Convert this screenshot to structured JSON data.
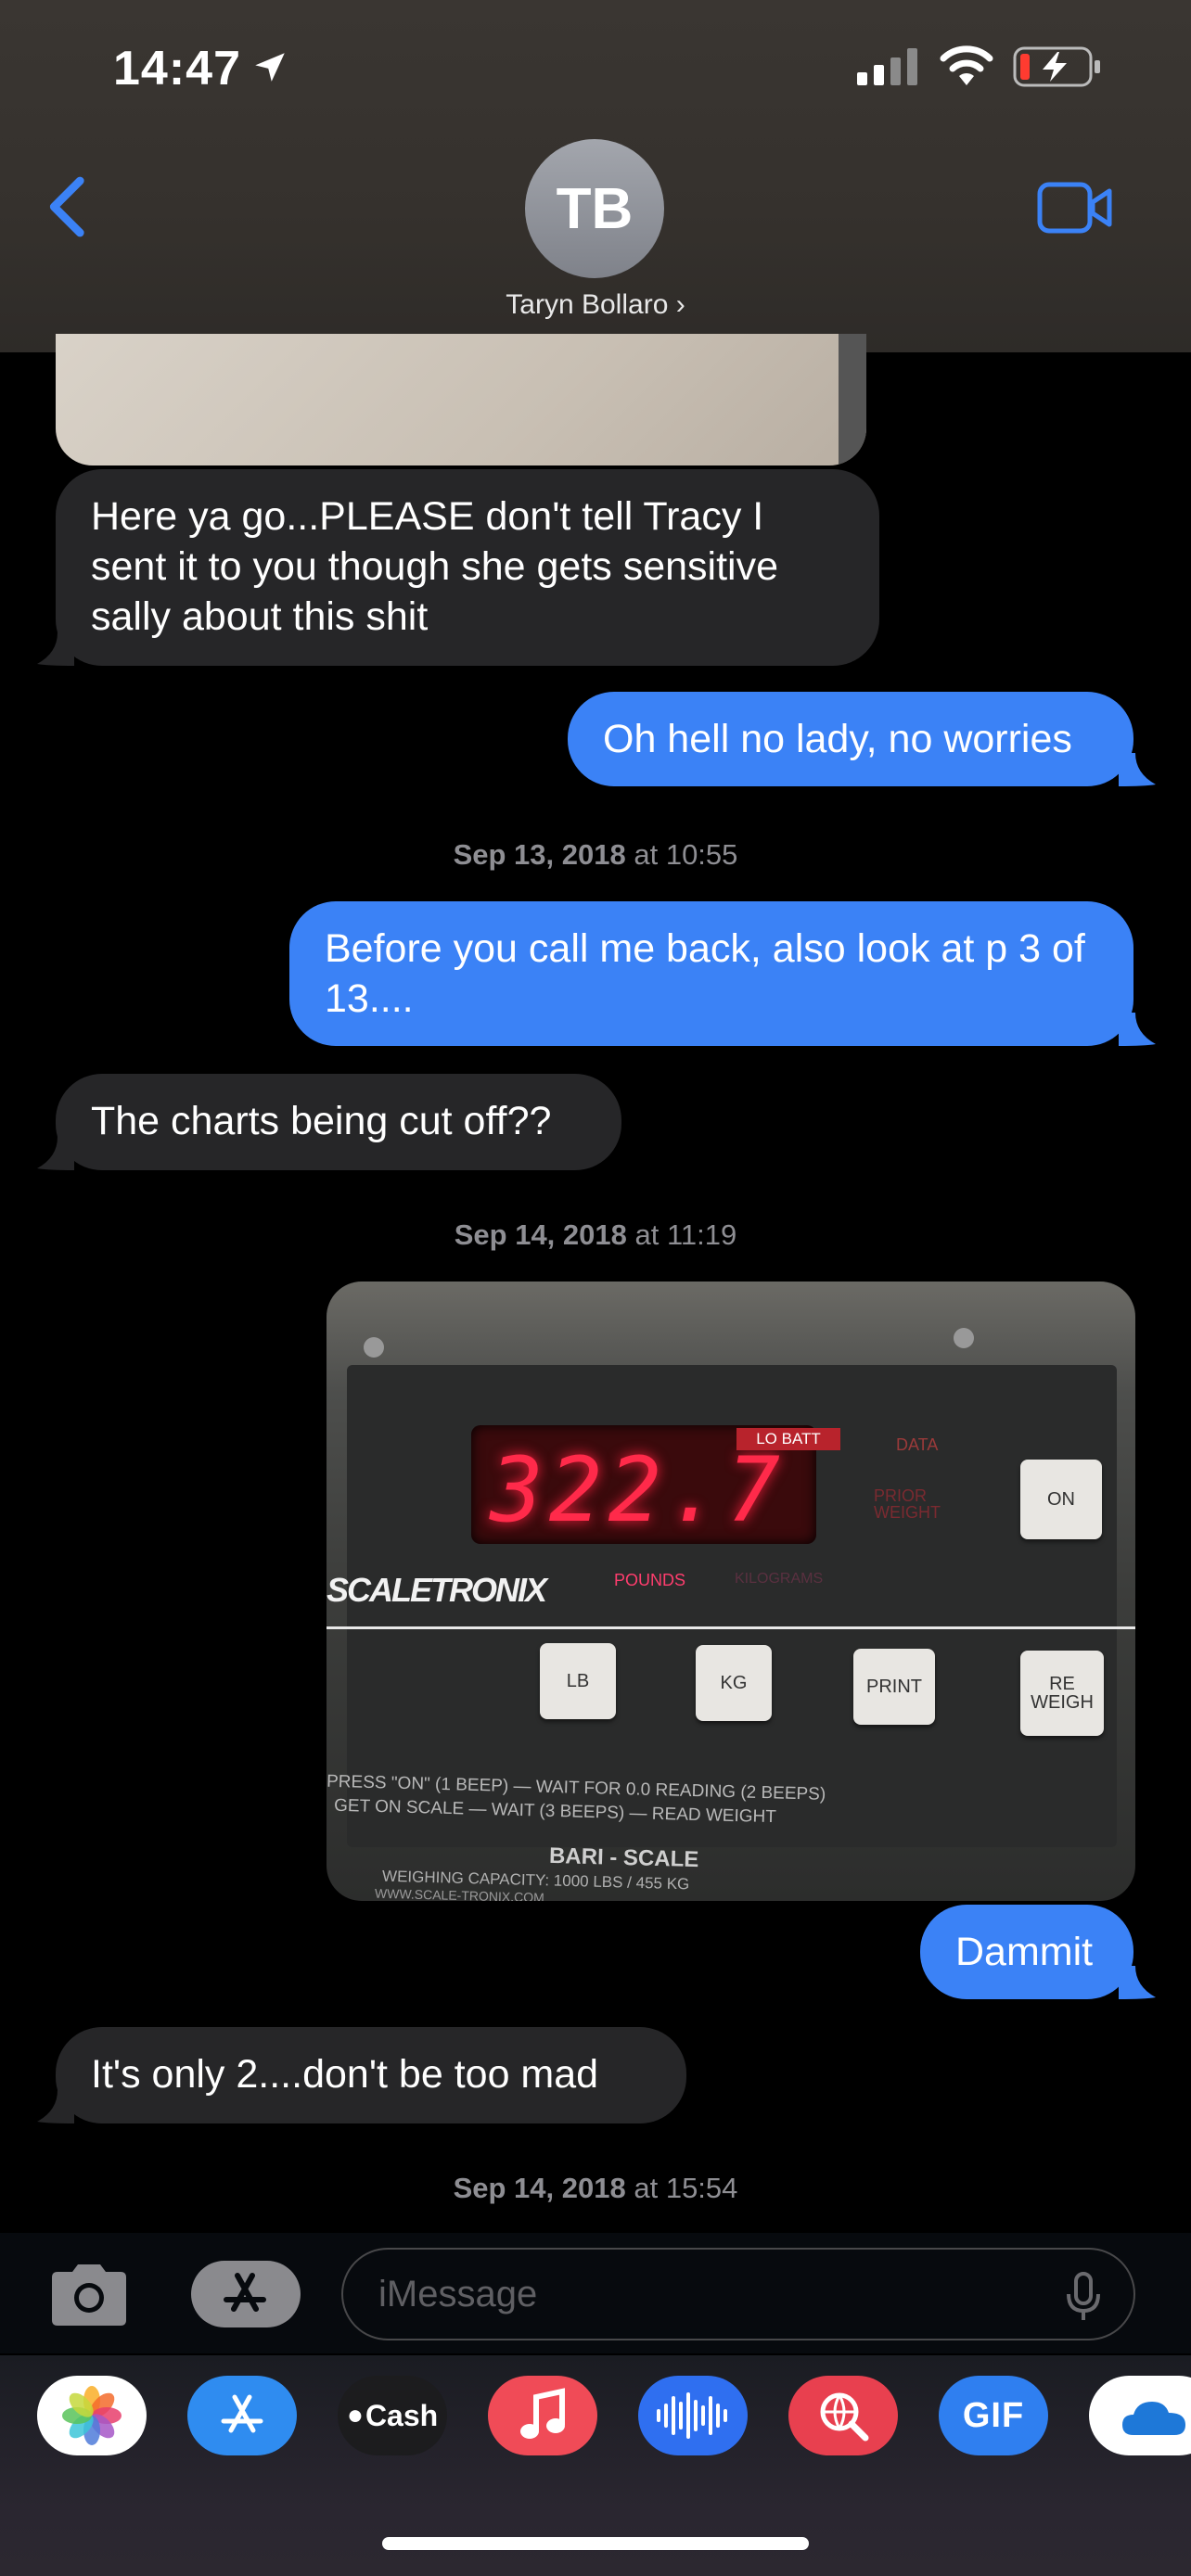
{
  "status_bar": {
    "time": "14:47"
  },
  "header": {
    "avatar_initials": "TB",
    "contact_name": "Taryn Bollaro ›"
  },
  "messages": [
    {
      "direction": "incoming",
      "text": "Here ya go...PLEASE don't tell Tracy I sent it to you though she gets sensitive sally about this shit"
    },
    {
      "direction": "outgoing",
      "text": "Oh hell no lady, no worries"
    },
    {
      "timestamp_date": "Sep 13, 2018",
      "timestamp_time": "at 10:55"
    },
    {
      "direction": "outgoing",
      "text": "Before you call me back, also look at p 3 of 13...."
    },
    {
      "direction": "incoming",
      "text": "The charts being cut off??"
    },
    {
      "timestamp_date": "Sep 14, 2018",
      "timestamp_time": "at 11:19"
    },
    {
      "direction": "outgoing",
      "text": "Dammit"
    },
    {
      "direction": "incoming",
      "text": "It's only 2....don't be too mad"
    },
    {
      "timestamp_date": "Sep 14, 2018",
      "timestamp_time": "at 15:54"
    }
  ],
  "scale_photo": {
    "display": "322.7",
    "lo_batt": "LO BATT",
    "data_label": "DATA",
    "prior_weight": "PRIOR WEIGHT",
    "on_button": "ON",
    "pounds": "POUNDS",
    "kilograms": "KILOGRAMS",
    "brand": "SCALETRONIX",
    "buttons": [
      "LB",
      "KG",
      "PRINT",
      "RE WEIGH"
    ],
    "instructions_1": "PRESS \"ON\" (1 BEEP) — WAIT FOR 0.0 READING (2 BEEPS)",
    "instructions_2": "GET ON SCALE — WAIT (3 BEEPS) — READ WEIGHT",
    "model": "BARI - SCALE",
    "capacity": "WEIGHING CAPACITY: 1000 LBS / 455 KG",
    "website": "WWW.SCALE-TRONIX.COM"
  },
  "input": {
    "placeholder": "iMessage"
  },
  "app_strip": [
    "Photos",
    "App Store",
    "Cash",
    "Music",
    "Voice",
    "Search",
    "GIF",
    "OneDrive"
  ],
  "app_labels": {
    "cash": "Cash",
    "gif": "GIF"
  },
  "colors": {
    "outgoing": "#3b82f6",
    "incoming": "#262628",
    "accent": "#3b82f6",
    "background": "#000000"
  }
}
